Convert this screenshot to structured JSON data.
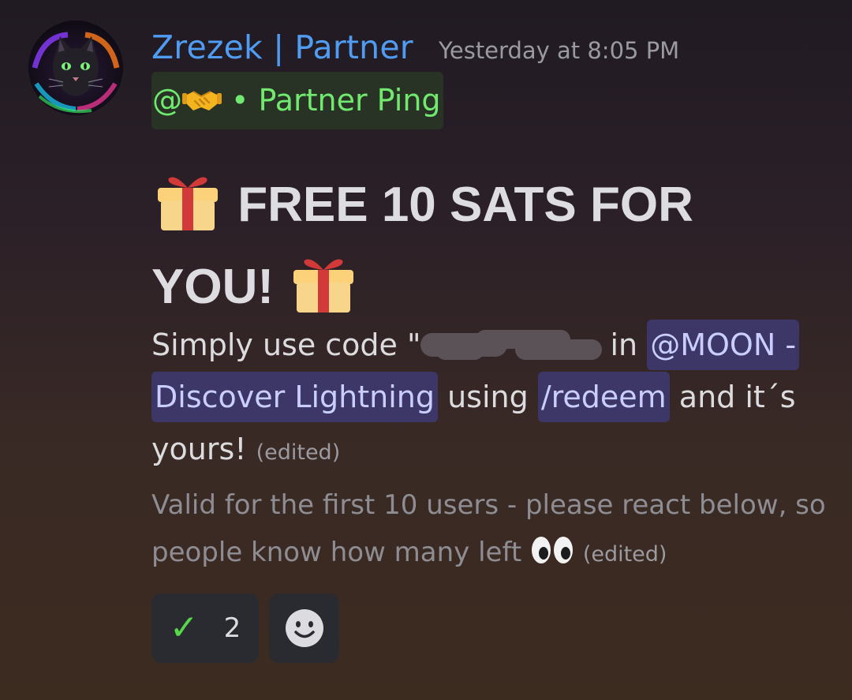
{
  "message": {
    "author": "Zrezek | Partner",
    "timestamp": "Yesterday at 8:05 PM",
    "avatar_icon": "cat-avatar-icon",
    "role_mention": {
      "prefix": "@",
      "icon": "handshake-icon",
      "label": "• Partner Ping"
    },
    "heading": {
      "icon": "gift-icon",
      "line1": "FREE 10 SATS FOR",
      "line2": "YOU!"
    },
    "body": {
      "part1": "Simply use code \"",
      "part2": "in ",
      "mention_app": "@MOON - Discover Lightning",
      "part3": " using ",
      "command": "/redeem",
      "part4": " and it´s yours!",
      "edited": "(edited)"
    },
    "note": {
      "text": "Valid for the first 10 users - please react below, so people know how many left",
      "icon": "eyes-icon",
      "edited": "(edited)"
    }
  },
  "reactions": [
    {
      "icon": "check-mark-icon",
      "count": "2"
    },
    {
      "icon": "add-reaction-icon"
    }
  ],
  "colors": {
    "username": "#4f9cf2",
    "role_text": "#71e96f",
    "role_bg": "#283326",
    "mention_bg": "#3c3766",
    "mention_text": "#c9ceff"
  }
}
